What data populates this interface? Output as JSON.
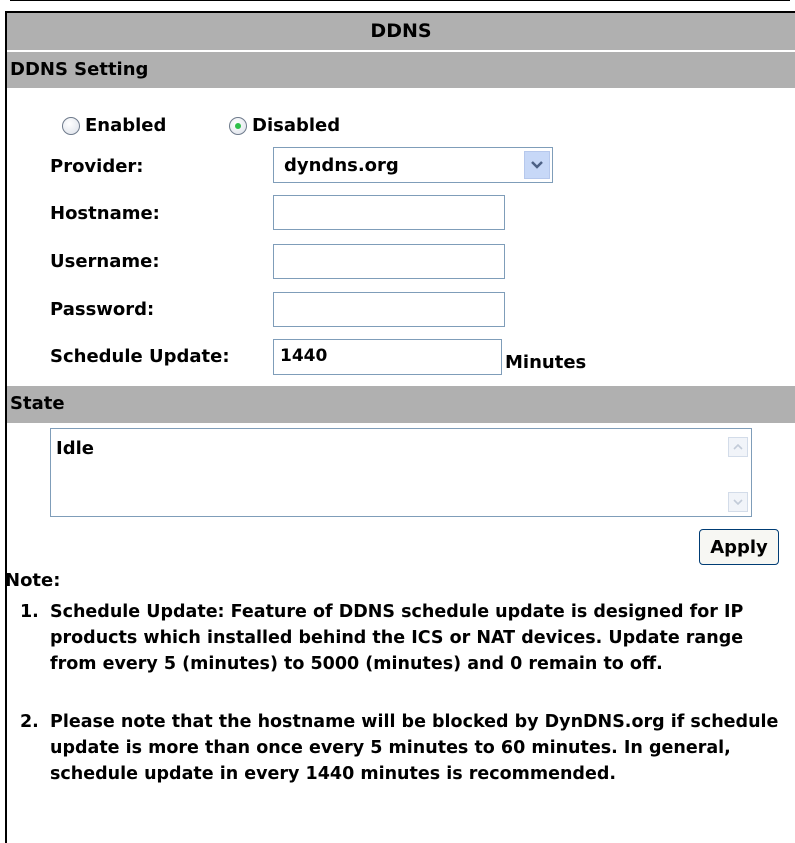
{
  "title": "DDNS",
  "setting_section": "DDNS Setting",
  "mode": {
    "enabled_label": "Enabled",
    "disabled_label": "Disabled",
    "selected": "Disabled"
  },
  "provider": {
    "label": "Provider:",
    "value": "dyndns.org"
  },
  "hostname": {
    "label": "Hostname:",
    "value": ""
  },
  "username": {
    "label": "Username:",
    "value": ""
  },
  "password": {
    "label": "Password:",
    "value": ""
  },
  "schedule": {
    "label": "Schedule Update:",
    "value": "1440",
    "unit": "Minutes"
  },
  "state_section": "State",
  "state_value": "Idle",
  "apply_label": "Apply",
  "note_heading": "Note:",
  "notes": [
    {
      "num": "1.",
      "text": "Schedule Update: Feature of DDNS schedule update is designed for IP products which installed behind the ICS or NAT devices. Update range from every 5 (minutes) to 5000 (minutes) and 0 remain to off."
    },
    {
      "num": "2.",
      "text": "Please note that the hostname will be blocked by DynDNS.org if schedule update is more than once every 5 minutes to 60 minutes. In general, schedule update in every 1440 minutes is recommended."
    }
  ]
}
